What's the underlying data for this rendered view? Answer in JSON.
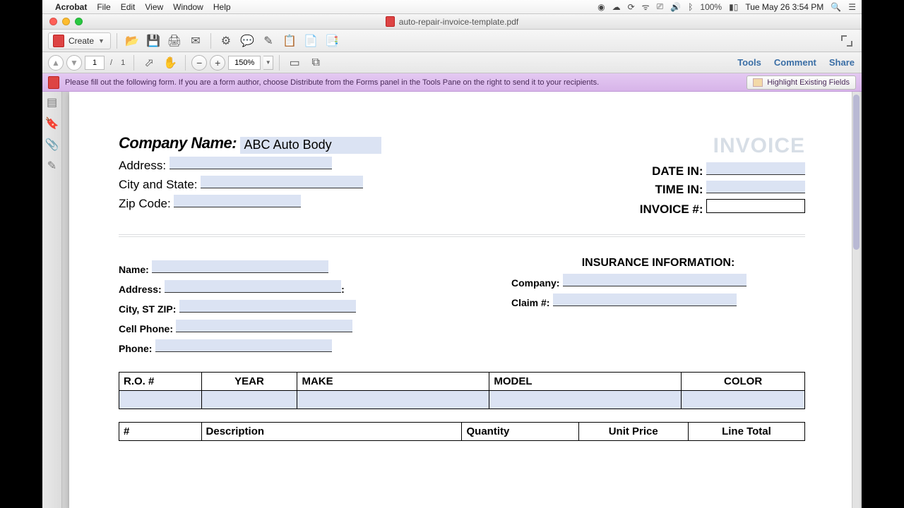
{
  "menubar": {
    "app": "Acrobat",
    "items": [
      "File",
      "Edit",
      "View",
      "Window",
      "Help"
    ],
    "battery": "100%",
    "clock": "Tue May 26  3:54 PM"
  },
  "window": {
    "title": "auto-repair-invoice-template.pdf"
  },
  "toolbar": {
    "create_label": "Create"
  },
  "subtoolbar": {
    "page_current": "1",
    "page_total": "1",
    "zoom": "150%",
    "links": {
      "tools": "Tools",
      "comment": "Comment",
      "share": "Share"
    }
  },
  "formbar": {
    "message": "Please fill out the following form. If you are a form author, choose Distribute from the Forms panel in the Tools Pane on the right to send it to your recipients.",
    "highlight_btn": "Highlight Existing Fields"
  },
  "pdf": {
    "invoice_word": "INVOICE",
    "company_name_label": "Company Name:",
    "company_name_value": "ABC Auto Body",
    "labels": {
      "address": "Address:",
      "city_state": "City and State:",
      "zip": "Zip Code:",
      "date_in": "DATE IN:",
      "time_in": "TIME IN:",
      "invoice_no": "INVOICE #:"
    },
    "customer": {
      "name": "Name:",
      "address": "Address:",
      "city": "City, ST ZIP:",
      "cell": "Cell Phone:",
      "phone": "Phone:"
    },
    "insurance": {
      "title": "INSURANCE INFORMATION:",
      "company": "Company:",
      "claim": "Claim #:"
    },
    "vehicle_headers": [
      "R.O. #",
      "YEAR",
      "MAKE",
      "MODEL",
      "COLOR"
    ],
    "items_headers": [
      "#",
      "Description",
      "Quantity",
      "Unit Price",
      "Line Total"
    ]
  }
}
